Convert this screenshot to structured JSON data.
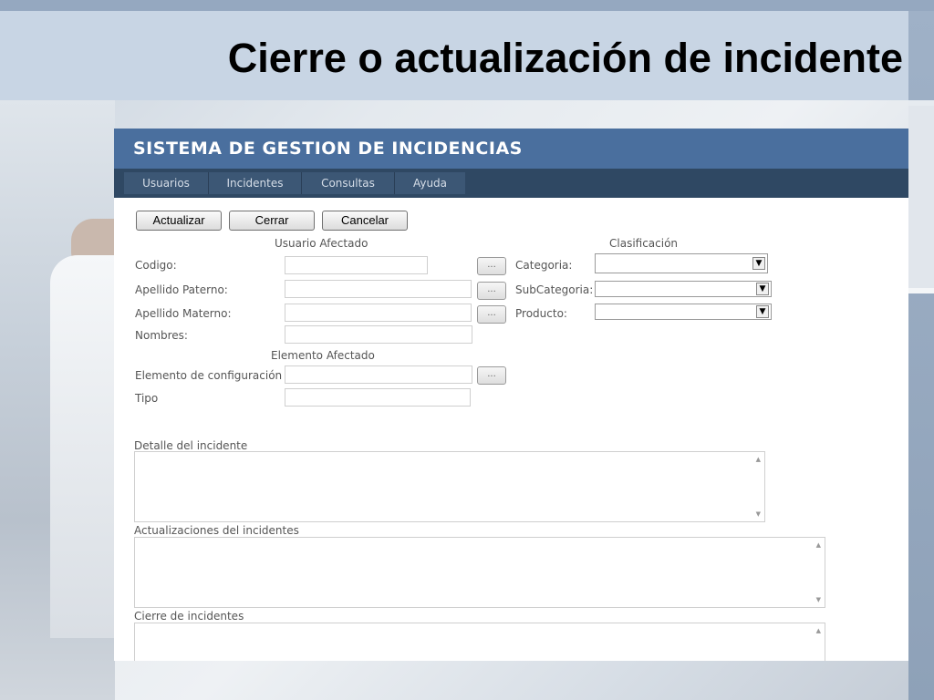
{
  "slide": {
    "title": "Cierre o actualización de incidente"
  },
  "app": {
    "title": "SISTEMA DE GESTION DE INCIDENCIAS",
    "menu": [
      "Usuarios",
      "Incidentes",
      "Consultas",
      "Ayuda"
    ]
  },
  "toolbar": {
    "update_label": "Actualizar",
    "close_label": "Cerrar",
    "cancel_label": "Cancelar"
  },
  "usuario_afectado": {
    "heading": "Usuario Afectado",
    "codigo": {
      "label": "Codigo:",
      "value": ""
    },
    "apellido_paterno": {
      "label": "Apellido Paterno:",
      "value": ""
    },
    "apellido_materno": {
      "label": "Apellido Materno:",
      "value": ""
    },
    "nombres": {
      "label": "Nombres:",
      "value": ""
    },
    "browse_label": "..."
  },
  "clasificacion": {
    "heading": "Clasificación",
    "categoria": {
      "label": "Categoria:",
      "value": ""
    },
    "subcategoria": {
      "label": "SubCategoria:",
      "value": ""
    },
    "producto": {
      "label": "Producto:",
      "value": ""
    },
    "dropdown_glyph": "▼"
  },
  "elemento_afectado": {
    "heading": "Elemento Afectado",
    "elemento": {
      "label": "Elemento de configuración",
      "value": ""
    },
    "tipo": {
      "label": "Tipo",
      "value": ""
    }
  },
  "detalle": {
    "label": "Detalle del incidente",
    "value": ""
  },
  "actualizaciones": {
    "label": "Actualizaciones del incidentes",
    "value": ""
  },
  "cierre": {
    "label": "Cierre de incidentes",
    "value": ""
  },
  "scroll_glyphs": {
    "up": "▲",
    "down": "▼"
  }
}
